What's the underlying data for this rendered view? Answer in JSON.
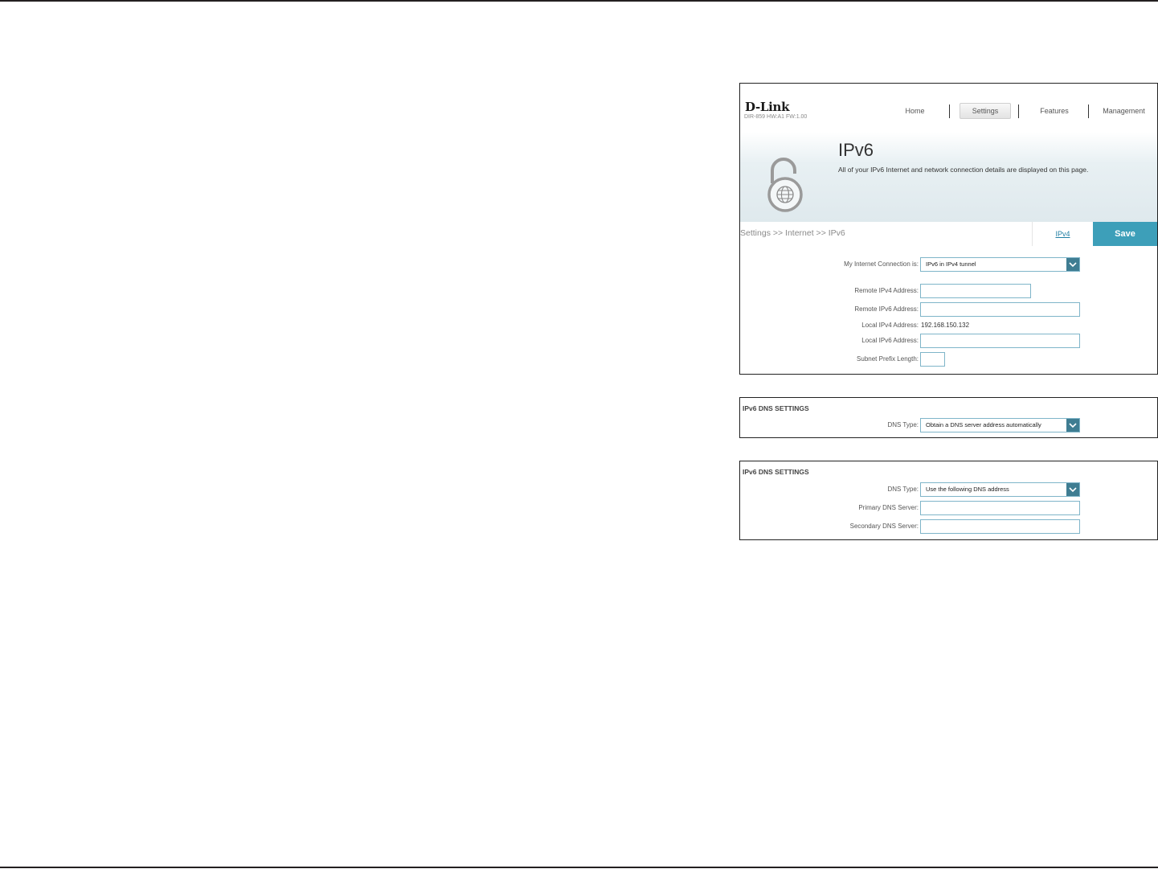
{
  "router": {
    "brand": "D-Link",
    "brand_sub": "DIR-859 HW:A1 FW:1.00",
    "nav": [
      "Home",
      "Settings",
      "Features",
      "Management"
    ],
    "page_title": "IPv6",
    "page_description": "All of your IPv6 Internet and network connection details are displayed on this page.",
    "breadcrumb": "Settings >> Internet >> IPv6",
    "ipv4_link": "IPv4",
    "save_label": "Save",
    "form": {
      "connection_label": "My Internet Connection is:",
      "connection_value": "IPv6 in IPv4 tunnel",
      "remote_ipv4_label": "Remote IPv4 Address:",
      "remote_ipv4_value": "",
      "remote_ipv6_label": "Remote IPv6 Address:",
      "remote_ipv6_value": "",
      "local_ipv4_label": "Local IPv4 Address:",
      "local_ipv4_value": "192.168.150.132",
      "local_ipv6_label": "Local IPv6 Address:",
      "local_ipv6_value": "",
      "prefix_label": "Subnet Prefix Length:",
      "prefix_value": ""
    }
  },
  "dns_auto": {
    "title": "IPv6 DNS SETTINGS",
    "type_label": "DNS Type:",
    "type_value": "Obtain a DNS server address automatically"
  },
  "dns_manual": {
    "title": "IPv6 DNS SETTINGS",
    "type_label": "DNS Type:",
    "type_value": "Use the following DNS address",
    "primary_label": "Primary DNS Server:",
    "primary_value": "",
    "secondary_label": "Secondary DNS Server:",
    "secondary_value": ""
  },
  "colors": {
    "accent": "#3d9fb9",
    "dropdown_arrow_bg": "#3f7d92",
    "link": "#1f7ea3"
  }
}
